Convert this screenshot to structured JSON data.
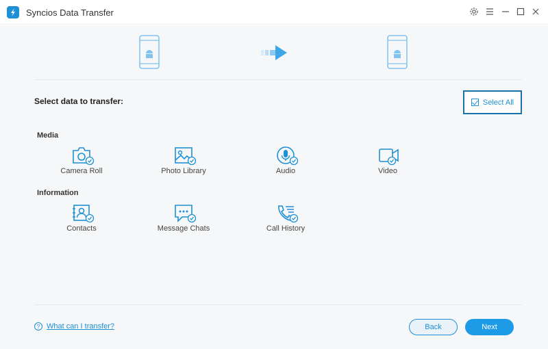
{
  "app": {
    "title": "Syncios Data Transfer"
  },
  "heading": "Select data to transfer:",
  "select_all_label": "Select All",
  "sections": {
    "media": {
      "label": "Media",
      "items": [
        "Camera Roll",
        "Photo Library",
        "Audio",
        "Video"
      ]
    },
    "information": {
      "label": "Information",
      "items": [
        "Contacts",
        "Message Chats",
        "Call History"
      ]
    }
  },
  "footer": {
    "help_link": "What can I transfer?",
    "back_label": "Back",
    "next_label": "Next"
  },
  "colors": {
    "accent": "#1d8fd6",
    "next_button": "#1d9be6",
    "background": "#f6f7f8"
  }
}
